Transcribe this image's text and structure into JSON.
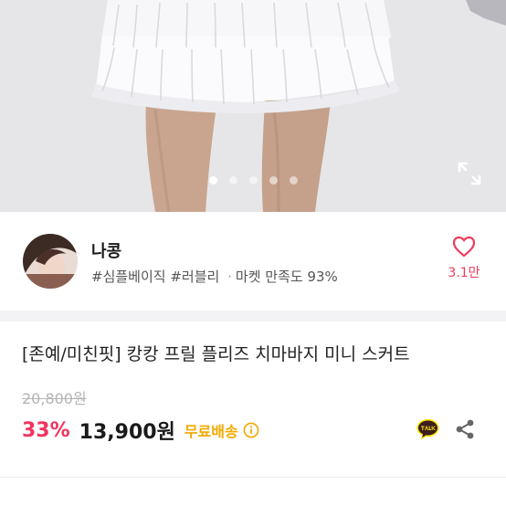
{
  "carousel": {
    "total": 5,
    "active_index": 0
  },
  "seller": {
    "name": "나콩",
    "tags": [
      "#심플베이직",
      "#러블리"
    ],
    "market_satisfaction": "마켓 만족도 93%",
    "separator": "·",
    "like_count": "3.1만"
  },
  "product": {
    "title": "[존예/미친핏] 캉캉 프릴 플리즈 치마바지 미니 스커트",
    "original_price": "20,800원",
    "discount": "33%",
    "price": "13,900원",
    "shipping": "무료배송"
  },
  "icons": {
    "expand": "expand-icon",
    "like": "heart-icon",
    "info": "info-icon",
    "talk": "kakao-talk-icon",
    "share": "share-icon"
  },
  "colors": {
    "accent": "#f0355f",
    "shipping": "#f2a900",
    "kakao_yellow": "#fee500",
    "talk_bubble": "#3b1e1e"
  }
}
